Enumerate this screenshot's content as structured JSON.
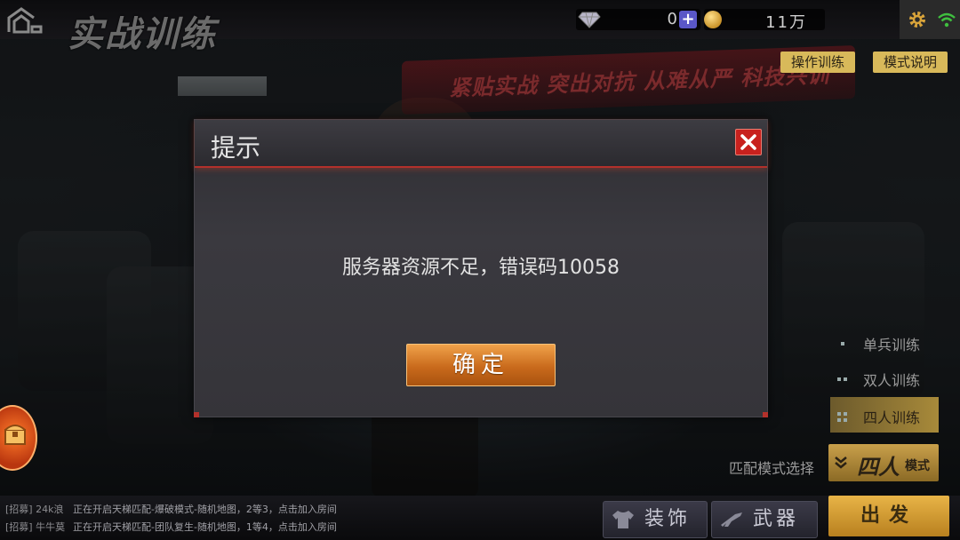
{
  "header": {
    "page_title": "实战训练",
    "gem_value": "0",
    "coin_value": "11万",
    "plus_label": "+"
  },
  "banner": {
    "text": "紧贴实战 突出对抗 从难从严 科技兴训"
  },
  "top_buttons": {
    "op_train": "操作训练",
    "mode_desc": "模式说明"
  },
  "mode_list": [
    {
      "label": "单兵训练",
      "active": false
    },
    {
      "label": "双人训练",
      "active": false
    },
    {
      "label": "四人训练",
      "active": true
    }
  ],
  "match": {
    "label": "匹配模式选择",
    "value": "四人",
    "suffix": "模式"
  },
  "chat": [
    {
      "tag": "[招募] 24k浪",
      "msg": "正在开启天梯匹配-爆破模式-随机地图，2等3，点击加入房间"
    },
    {
      "tag": "[招募] 牛牛莫",
      "msg": "正在开启天梯匹配-团队复生-随机地图，1等4，点击加入房间"
    }
  ],
  "bottom_buttons": {
    "outfit": "装饰",
    "weapon": "武器",
    "sortie": "出发"
  },
  "dialog": {
    "title": "提示",
    "message": "服务器资源不足，错误码10058",
    "confirm": "确定"
  },
  "colors": {
    "accent_red": "#c8211e",
    "confirm_orange": "#e08a35",
    "gold": "#d8b95a"
  }
}
